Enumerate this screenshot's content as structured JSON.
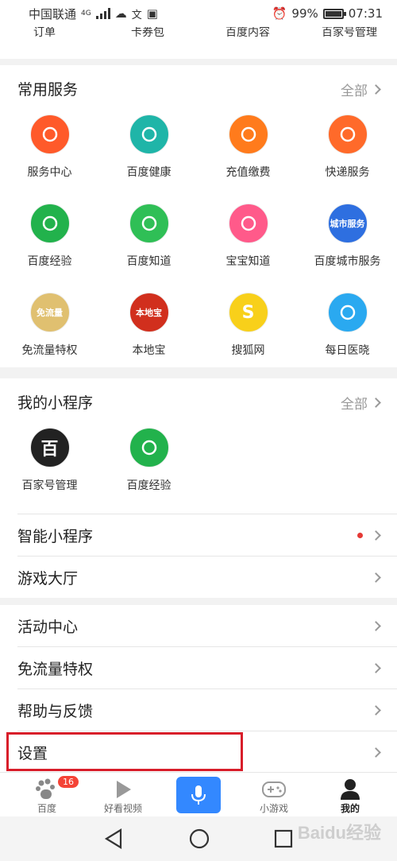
{
  "status_bar": {
    "carrier": "中国联通",
    "net": "4G",
    "battery": "99%",
    "time": "07:31"
  },
  "top_row": [
    "订单",
    "卡券包",
    "百度内容",
    "百家号管理"
  ],
  "common_services": {
    "title": "常用服务",
    "more": "全部",
    "items": [
      {
        "label": "服务中心",
        "icon": "service-center-icon",
        "color": "#ff5a2a"
      },
      {
        "label": "百度健康",
        "icon": "health-icon",
        "color": "#1fb5a8"
      },
      {
        "label": "充值缴费",
        "icon": "recharge-icon",
        "color": "#ff7b1c"
      },
      {
        "label": "快递服务",
        "icon": "express-icon",
        "color": "#ff6a2a"
      },
      {
        "label": "百度经验",
        "icon": "experience-bulb-icon",
        "color": "#22b24c"
      },
      {
        "label": "百度知道",
        "icon": "question-icon",
        "color": "#2fbf56"
      },
      {
        "label": "宝宝知道",
        "icon": "baby-icon",
        "color": "#ff5a8a"
      },
      {
        "label": "百度城市服务",
        "icon": "city-service-icon",
        "color": "#2e6fe0",
        "icon_text": "城市服务"
      },
      {
        "label": "免流量特权",
        "icon": "free-traffic-icon",
        "color": "#e0c070",
        "icon_text": "免流量"
      },
      {
        "label": "本地宝",
        "icon": "bendibao-icon",
        "color": "#d12f1d",
        "icon_text": "本地宝"
      },
      {
        "label": "搜狐网",
        "icon": "sohu-icon",
        "color": "#f8d01a",
        "icon_text": "S"
      },
      {
        "label": "每日医晓",
        "icon": "medical-icon",
        "color": "#2aa9f0"
      }
    ]
  },
  "mini_programs": {
    "title": "我的小程序",
    "more": "全部",
    "items": [
      {
        "label": "百家号管理",
        "icon": "baijiahao-icon",
        "color": "#222222",
        "icon_text": "百"
      },
      {
        "label": "百度经验",
        "icon": "experience-bulb-icon",
        "color": "#22b24c"
      }
    ]
  },
  "menu_rows": {
    "smart_mini": "智能小程序",
    "game_hall": "游戏大厅",
    "activity": "活动中心",
    "free_traffic": "免流量特权",
    "help": "帮助与反馈",
    "settings": "设置"
  },
  "tabs": {
    "baidu": "百度",
    "baidu_badge": "16",
    "video": "好看视频",
    "games": "小游戏",
    "mine": "我的"
  },
  "watermark": "Baidu经验",
  "colors": {
    "accent": "#3388ff",
    "highlight": "#d81e2a",
    "dot": "#e53935"
  }
}
